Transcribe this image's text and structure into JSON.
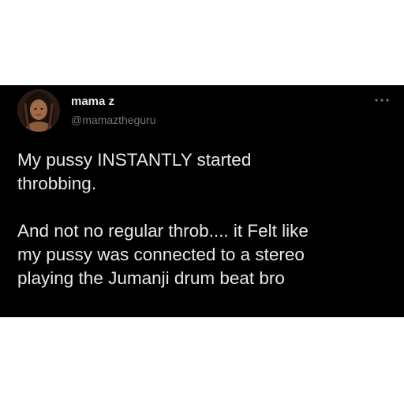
{
  "tweet": {
    "author": {
      "display_name": "mama z",
      "handle": "@mamaztheguru",
      "avatar_icon": "avatar-photo"
    },
    "more_icon": "more-horizontal-icon",
    "paragraphs": [
      "My pussy INSTANTLY started\nthrobbing.",
      "And not no regular throb.... it Felt like\nmy pussy was connected to a stereo\nplaying the Jumanji drum beat bro"
    ]
  },
  "colors": {
    "page_background": "#ffffff",
    "card_background": "#000000",
    "primary_text": "#e7e9ea",
    "secondary_text": "#71767b"
  }
}
